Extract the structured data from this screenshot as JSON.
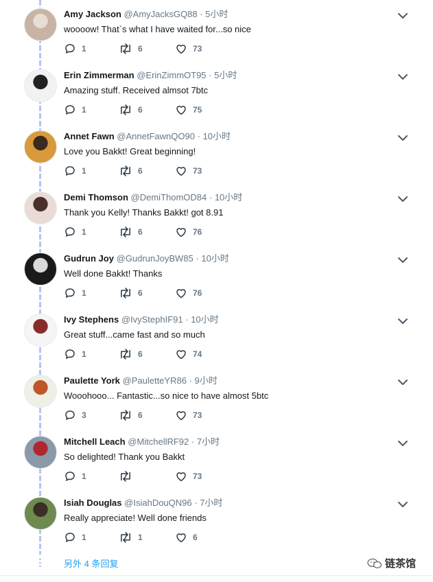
{
  "colors": {
    "accent": "#1da1f2",
    "muted": "#657786",
    "thread": "#b5c3f2"
  },
  "tweets": [
    {
      "name": "Amy Jackson",
      "handle": "@AmyJacksGQ88",
      "sep": " · ",
      "time": "5小时",
      "text": "woooow! That`s what I have waited for...so nice",
      "replies": "1",
      "retweets": "6",
      "likes": "73",
      "avatar_colors": [
        "#c9b3a4",
        "#e8ddd5"
      ]
    },
    {
      "name": "Erin Zimmerman",
      "handle": "@ErinZimmOT95",
      "sep": " · ",
      "time": "5小时",
      "text": "Amazing stuff. Received almsot 7btc",
      "replies": "1",
      "retweets": "6",
      "likes": "75",
      "avatar_colors": [
        "#f2f2f2",
        "#222222"
      ]
    },
    {
      "name": "Annet Fawn",
      "handle": "@AnnetFawnQO90",
      "sep": " · ",
      "time": "10小时",
      "text": "Love you Bakkt! Great beginning!",
      "replies": "1",
      "retweets": "6",
      "likes": "73",
      "avatar_colors": [
        "#d89a3a",
        "#3b2a1e"
      ]
    },
    {
      "name": "Demi Thomson",
      "handle": "@DemiThomOD84",
      "sep": " · ",
      "time": "10小时",
      "text": "Thank you Kelly! Thanks Bakkt! got 8.91",
      "replies": "1",
      "retweets": "6",
      "likes": "76",
      "avatar_colors": [
        "#e9dcd6",
        "#4a2f2a"
      ]
    },
    {
      "name": "Gudrun Joy",
      "handle": "@GudrunJoyBW85",
      "sep": " · ",
      "time": "10小时",
      "text": "Well done Bakkt! Thanks",
      "replies": "1",
      "retweets": "6",
      "likes": "76",
      "avatar_colors": [
        "#1a1a1a",
        "#d9d9d9"
      ]
    },
    {
      "name": "Ivy Stephens",
      "handle": "@IvyStephIF91",
      "sep": " · ",
      "time": "10小时",
      "text": "Great stuff...came fast and so much",
      "replies": "1",
      "retweets": "6",
      "likes": "74",
      "avatar_colors": [
        "#f5f5f5",
        "#8a2b2b"
      ]
    },
    {
      "name": "Paulette York",
      "handle": "@PauletteYR86",
      "sep": " · ",
      "time": "9小时",
      "text": "Wooohooo... Fantastic...so nice to have almost 5btc",
      "replies": "3",
      "retweets": "6",
      "likes": "73",
      "avatar_colors": [
        "#eef0e6",
        "#c0552a"
      ]
    },
    {
      "name": "Mitchell Leach",
      "handle": "@MitchellRF92",
      "sep": " · ",
      "time": "7小时",
      "text": "So delighted! Thank you Bakkt",
      "replies": "1",
      "retweets": "",
      "likes": "73",
      "avatar_colors": [
        "#8a9aa8",
        "#b0262e"
      ]
    },
    {
      "name": "Isiah Douglas",
      "handle": "@IsiahDouQN96",
      "sep": " · ",
      "time": "7小时",
      "text": "Really appreciate! Well done friends",
      "replies": "1",
      "retweets": "1",
      "likes": "6",
      "avatar_colors": [
        "#6f8a4f",
        "#3a2e26"
      ]
    }
  ],
  "more_replies": "另外 4 条回复",
  "watermark": "链茶馆",
  "icons": {
    "reply": "reply-icon",
    "retweet": "retweet-icon",
    "like": "heart-icon",
    "menu": "chevron-down-icon"
  }
}
